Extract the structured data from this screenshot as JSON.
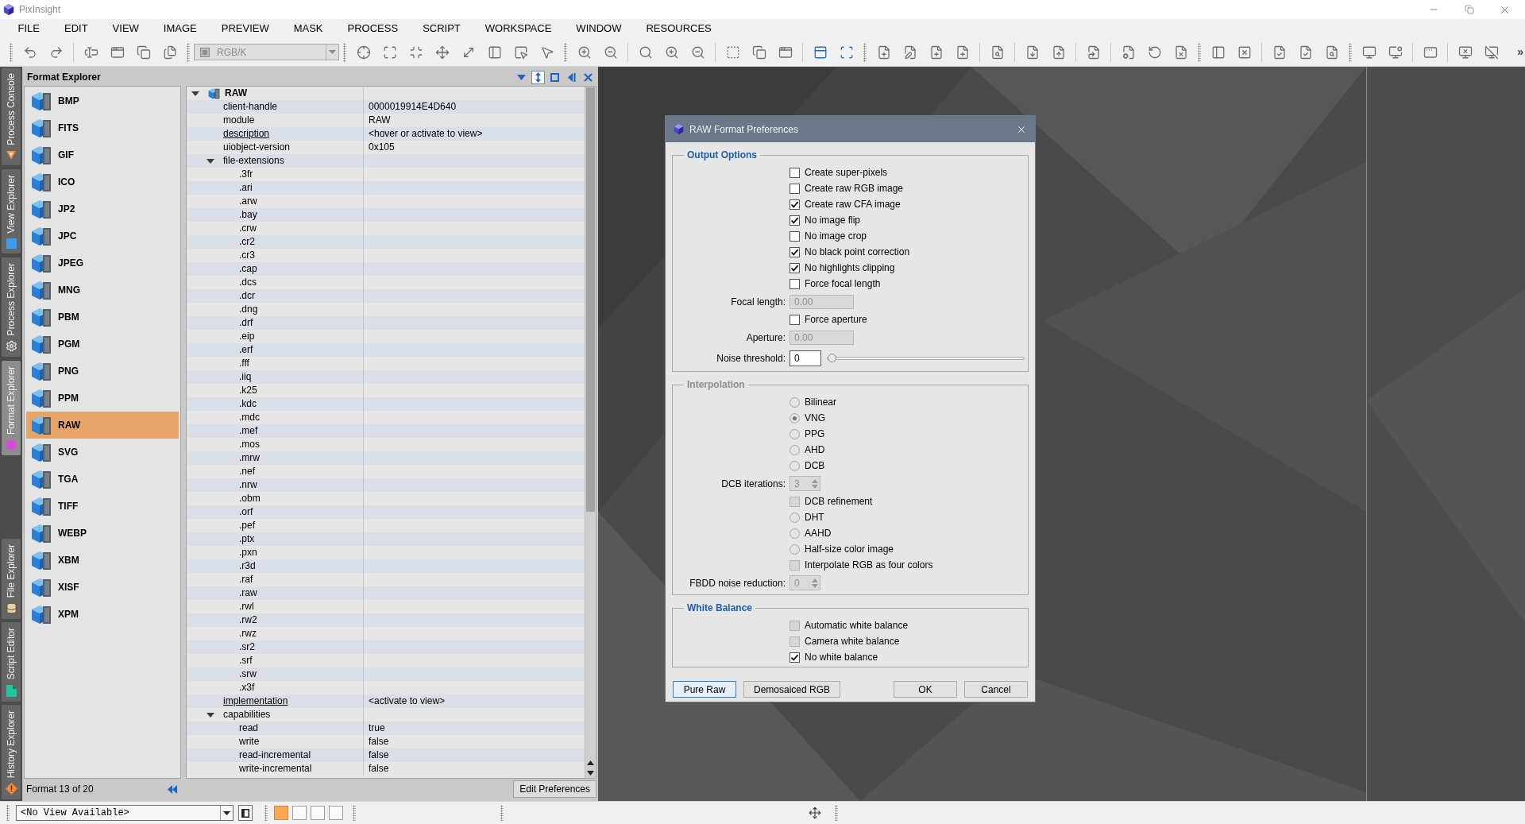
{
  "window": {
    "title": "PixInsight"
  },
  "menu": [
    "FILE",
    "EDIT",
    "VIEW",
    "IMAGE",
    "PREVIEW",
    "MASK",
    "PROCESS",
    "SCRIPT",
    "WORKSPACE",
    "WINDOW",
    "RESOURCES"
  ],
  "toolbar": {
    "view_mode": {
      "value": "RGB/K",
      "disabled": true
    },
    "overflow": "»"
  },
  "side_tabs": {
    "top": [
      {
        "label": "Process Console",
        "selected": false
      },
      {
        "label": "View Explorer",
        "selected": false
      },
      {
        "label": "Process Explorer",
        "selected": false
      },
      {
        "label": "Format Explorer",
        "selected": true
      }
    ],
    "bottom": [
      {
        "label": "File Explorer",
        "selected": false
      },
      {
        "label": "Script Editor",
        "selected": false
      },
      {
        "label": "History Explorer",
        "selected": false
      }
    ]
  },
  "format_explorer": {
    "title": "Format Explorer",
    "header_buttons": [
      {
        "selected": false
      },
      {
        "selected": true
      },
      {
        "selected": false
      },
      {
        "selected": false
      },
      {
        "selected": false
      }
    ],
    "formats": [
      {
        "name": "BMP",
        "selected": false
      },
      {
        "name": "FITS",
        "selected": false
      },
      {
        "name": "GIF",
        "selected": false
      },
      {
        "name": "ICO",
        "selected": false
      },
      {
        "name": "JP2",
        "selected": false
      },
      {
        "name": "JPC",
        "selected": false
      },
      {
        "name": "JPEG",
        "selected": false
      },
      {
        "name": "MNG",
        "selected": false
      },
      {
        "name": "PBM",
        "selected": false
      },
      {
        "name": "PGM",
        "selected": false
      },
      {
        "name": "PNG",
        "selected": false
      },
      {
        "name": "PPM",
        "selected": false
      },
      {
        "name": "RAW",
        "selected": true
      },
      {
        "name": "SVG",
        "selected": false
      },
      {
        "name": "TGA",
        "selected": false
      },
      {
        "name": "TIFF",
        "selected": false
      },
      {
        "name": "WEBP",
        "selected": false
      },
      {
        "name": "XBM",
        "selected": false
      },
      {
        "name": "XISF",
        "selected": false
      },
      {
        "name": "XPM",
        "selected": false
      }
    ],
    "tree": [
      {
        "kind": "object",
        "label": "RAW",
        "expanded": true,
        "children": [
          {
            "kind": "property",
            "label": "client-handle",
            "value": "0000019914E4D640"
          },
          {
            "kind": "property",
            "label": "module",
            "value": "RAW"
          },
          {
            "kind": "link",
            "label": "description",
            "value": "<hover or activate to view>"
          },
          {
            "kind": "property",
            "label": "uiobject-version",
            "value": "0x105"
          },
          {
            "kind": "group",
            "label": "file-extensions",
            "expanded": true,
            "children": [
              {
                "kind": "property",
                "label": ".3fr"
              },
              {
                "kind": "property",
                "label": ".ari"
              },
              {
                "kind": "property",
                "label": ".arw"
              },
              {
                "kind": "property",
                "label": ".bay"
              },
              {
                "kind": "property",
                "label": ".crw"
              },
              {
                "kind": "property",
                "label": ".cr2"
              },
              {
                "kind": "property",
                "label": ".cr3"
              },
              {
                "kind": "property",
                "label": ".cap"
              },
              {
                "kind": "property",
                "label": ".dcs"
              },
              {
                "kind": "property",
                "label": ".dcr"
              },
              {
                "kind": "property",
                "label": ".dng"
              },
              {
                "kind": "property",
                "label": ".drf"
              },
              {
                "kind": "property",
                "label": ".eip"
              },
              {
                "kind": "property",
                "label": ".erf"
              },
              {
                "kind": "property",
                "label": ".fff"
              },
              {
                "kind": "property",
                "label": ".iiq"
              },
              {
                "kind": "property",
                "label": ".k25"
              },
              {
                "kind": "property",
                "label": ".kdc"
              },
              {
                "kind": "property",
                "label": ".mdc"
              },
              {
                "kind": "property",
                "label": ".mef"
              },
              {
                "kind": "property",
                "label": ".mos"
              },
              {
                "kind": "property",
                "label": ".mrw"
              },
              {
                "kind": "property",
                "label": ".nef"
              },
              {
                "kind": "property",
                "label": ".nrw"
              },
              {
                "kind": "property",
                "label": ".obm"
              },
              {
                "kind": "property",
                "label": ".orf"
              },
              {
                "kind": "property",
                "label": ".pef"
              },
              {
                "kind": "property",
                "label": ".ptx"
              },
              {
                "kind": "property",
                "label": ".pxn"
              },
              {
                "kind": "property",
                "label": ".r3d"
              },
              {
                "kind": "property",
                "label": ".raf"
              },
              {
                "kind": "property",
                "label": ".raw"
              },
              {
                "kind": "property",
                "label": ".rwl"
              },
              {
                "kind": "property",
                "label": ".rw2"
              },
              {
                "kind": "property",
                "label": ".rwz"
              },
              {
                "kind": "property",
                "label": ".sr2"
              },
              {
                "kind": "property",
                "label": ".srf"
              },
              {
                "kind": "property",
                "label": ".srw"
              },
              {
                "kind": "property",
                "label": ".x3f"
              }
            ]
          },
          {
            "kind": "link",
            "label": "implementation",
            "value": "<activate to view>"
          },
          {
            "kind": "group",
            "label": "capabilities",
            "expanded": true,
            "children": [
              {
                "kind": "property",
                "label": "read",
                "value": "true"
              },
              {
                "kind": "property",
                "label": "write",
                "value": "false"
              },
              {
                "kind": "property",
                "label": "read-incremental",
                "value": "false"
              },
              {
                "kind": "property",
                "label": "write-incremental",
                "value": "false"
              }
            ]
          }
        ]
      }
    ],
    "status": "Format 13 of 20",
    "edit_button": "Edit Preferences"
  },
  "dialog": {
    "title": "RAW Format Preferences",
    "groups": [
      {
        "title": "Output Options",
        "disabled": false,
        "rows": [
          {
            "kind": "checkbox",
            "label": "Create super-pixels",
            "checked": false,
            "disabled": false
          },
          {
            "kind": "checkbox",
            "label": "Create raw RGB image",
            "checked": false,
            "disabled": false
          },
          {
            "kind": "checkbox",
            "label": "Create raw CFA image",
            "checked": true,
            "disabled": false
          },
          {
            "kind": "checkbox",
            "label": "No image flip",
            "checked": true,
            "disabled": false
          },
          {
            "kind": "checkbox",
            "label": "No image crop",
            "checked": false,
            "disabled": false
          },
          {
            "kind": "checkbox",
            "label": "No black point correction",
            "checked": true,
            "disabled": false
          },
          {
            "kind": "checkbox",
            "label": "No highlights clipping",
            "checked": true,
            "disabled": false
          },
          {
            "kind": "checkbox",
            "label": "Force focal length",
            "checked": false,
            "disabled": false
          },
          {
            "kind": "number",
            "label": "Focal length:",
            "value": "0.00",
            "disabled": true
          },
          {
            "kind": "checkbox",
            "label": "Force aperture",
            "checked": false,
            "disabled": false
          },
          {
            "kind": "number",
            "label": "Aperture:",
            "value": "0.00",
            "disabled": true
          },
          {
            "kind": "slider",
            "label": "Noise threshold:",
            "value": "0",
            "level": 0
          }
        ]
      },
      {
        "title": "Interpolation",
        "disabled": true,
        "rows": [
          {
            "kind": "radio",
            "label": "Bilinear",
            "selected": false
          },
          {
            "kind": "radio",
            "label": "VNG",
            "selected": true
          },
          {
            "kind": "radio",
            "label": "PPG",
            "selected": false
          },
          {
            "kind": "radio",
            "label": "AHD",
            "selected": false
          },
          {
            "kind": "radio",
            "label": "DCB",
            "selected": false
          },
          {
            "kind": "spin",
            "label": "DCB iterations:",
            "value": "3",
            "disabled": true
          },
          {
            "kind": "checkbox",
            "label": "DCB refinement",
            "checked": false,
            "disabled": true
          },
          {
            "kind": "radio",
            "label": "DHT",
            "selected": false
          },
          {
            "kind": "radio",
            "label": "AAHD",
            "selected": false
          },
          {
            "kind": "radio",
            "label": "Half-size color image",
            "selected": false
          },
          {
            "kind": "checkbox",
            "label": "Interpolate RGB as four colors",
            "checked": false,
            "disabled": true
          },
          {
            "kind": "spin",
            "label": "FBDD noise reduction:",
            "value": "0",
            "disabled": true
          }
        ]
      },
      {
        "title": "White Balance",
        "disabled": false,
        "rows": [
          {
            "kind": "checkbox",
            "label": "Automatic white balance",
            "checked": false,
            "disabled": true
          },
          {
            "kind": "checkbox",
            "label": "Camera white balance",
            "checked": false,
            "disabled": true
          },
          {
            "kind": "checkbox",
            "label": "No white balance",
            "checked": true,
            "disabled": false
          }
        ]
      }
    ],
    "buttons_left": [
      {
        "label": "Pure Raw",
        "focused": true
      },
      {
        "label": "Demosaiced RGB",
        "focused": false
      }
    ],
    "buttons_right": [
      {
        "label": "OK",
        "focused": false
      },
      {
        "label": "Cancel",
        "focused": false
      }
    ]
  },
  "status_bar": {
    "view_selector": "<No View Available>",
    "workspaces": [
      {
        "selected": true
      },
      {
        "selected": false
      },
      {
        "selected": false
      },
      {
        "selected": false
      }
    ]
  }
}
